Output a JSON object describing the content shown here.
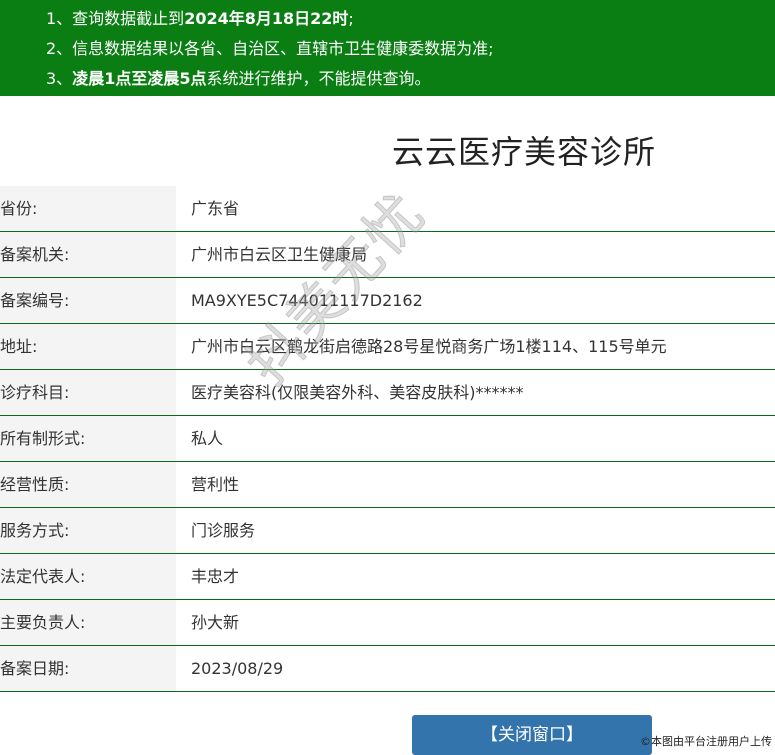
{
  "notice": {
    "line1_prefix": "1、查询数据截止到",
    "line1_bold": "2024年8月18日22时",
    "line1_suffix": ";",
    "line2": "2、信息数据结果以各省、自治区、直辖市卫生健康委数据为准;",
    "line3_prefix": "3、",
    "line3_bold": "凌晨1点至凌晨5点",
    "line3_suffix": "系统进行维护，不能提供查询。"
  },
  "title": "云云医疗美容诊所",
  "rows": [
    {
      "label": "省份:",
      "value": "广东省"
    },
    {
      "label": "备案机关:",
      "value": "广州市白云区卫生健康局"
    },
    {
      "label": "备案编号:",
      "value": "MA9XYE5C744011117D2162"
    },
    {
      "label": "地址:",
      "value": "广州市白云区鹤龙街启德路28号星悦商务广场1楼114、115号单元"
    },
    {
      "label": "诊疗科目:",
      "value": "医疗美容科(仅限美容外科、美容皮肤科)******"
    },
    {
      "label": "所有制形式:",
      "value": "私人"
    },
    {
      "label": "经营性质:",
      "value": "营利性"
    },
    {
      "label": "服务方式:",
      "value": "门诊服务"
    },
    {
      "label": "法定代表人:",
      "value": "丰忠才"
    },
    {
      "label": "主要负责人:",
      "value": "孙大新"
    },
    {
      "label": "备案日期:",
      "value": "2023/08/29"
    }
  ],
  "watermark": "抖美无忧",
  "close_button": "【关闭窗口】",
  "credit": "©本图由平台注册用户上传",
  "colors": {
    "notice_bg": "#0a7e12",
    "row_border": "#0a6a1a",
    "button_bg": "#3474ad"
  }
}
